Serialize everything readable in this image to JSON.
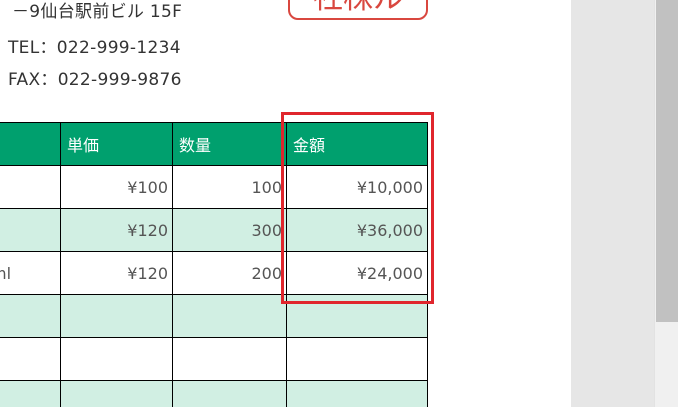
{
  "address": {
    "line1": "－9仙台駅前ビル 15F",
    "tel": "TEL：022-999-1234",
    "fax": "FAX：022-999-9876"
  },
  "seal_text": "社株ル",
  "table": {
    "headers": [
      "",
      "単価",
      "数量",
      "金額"
    ],
    "rows": [
      [
        "",
        "¥100",
        "100",
        "¥10,000"
      ],
      [
        "",
        "¥120",
        "300",
        "¥36,000"
      ],
      [
        "ml",
        "¥120",
        "200",
        "¥24,000"
      ],
      [
        "",
        "",
        "",
        ""
      ],
      [
        "",
        "",
        "",
        ""
      ],
      [
        "",
        "",
        "",
        ""
      ]
    ]
  },
  "colors": {
    "header_bg": "#00a06e",
    "alt_row_bg": "#d1efe3",
    "highlight": "#e0262d",
    "seal": "#d9473f"
  }
}
